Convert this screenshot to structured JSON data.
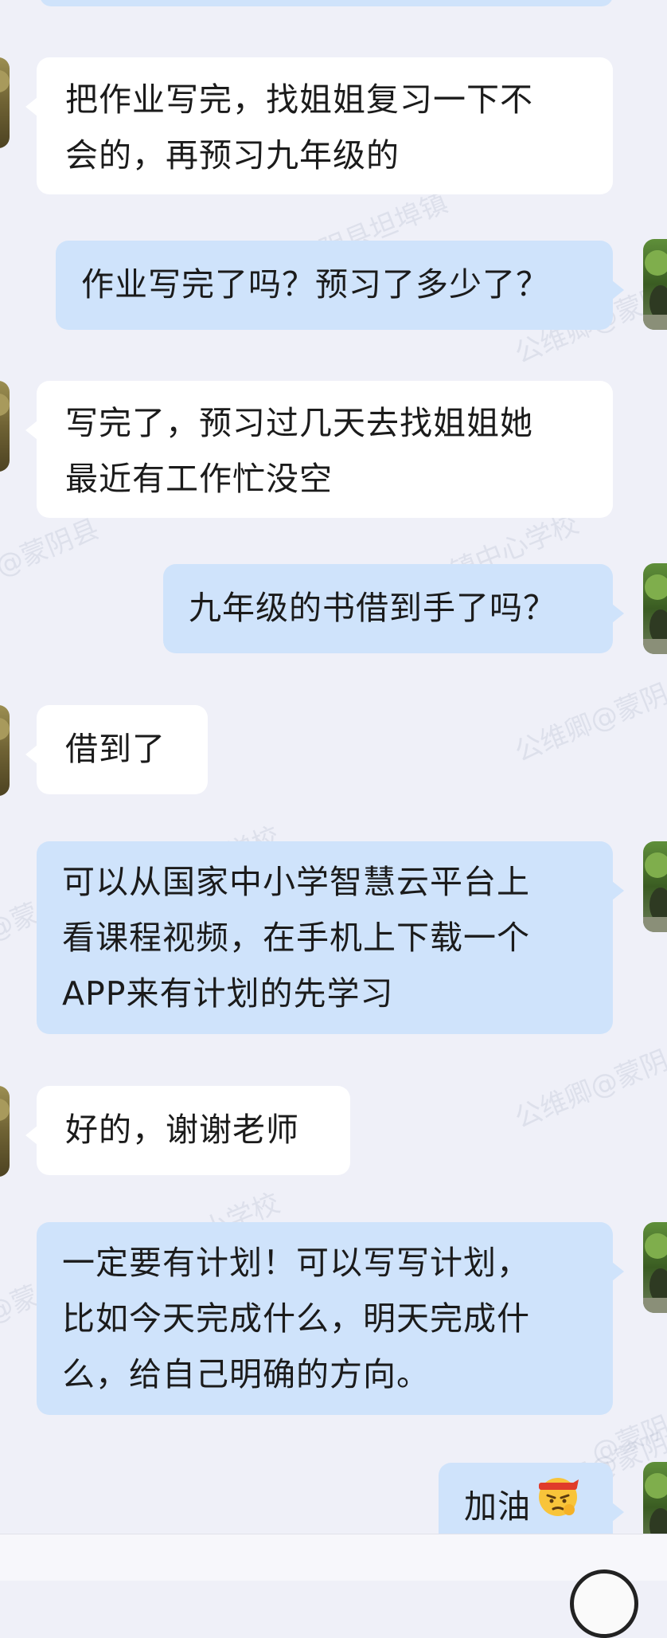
{
  "watermarks": [
    "@蒙阴县坦埠镇",
    "公维卿@蒙阴",
    "@蒙阴县",
    "镇中心学校",
    "公维卿@蒙阴",
    "小学校",
    "@蒙",
    "公维卿@蒙阴",
    "小学校",
    "@蒙",
    "公维卿@蒙阴",
    "@蒙阴"
  ],
  "messages": [
    {
      "side": "in",
      "lines": [
        "把作业写完，找姐姐复习一下不",
        "会的，再预习九年级的"
      ]
    },
    {
      "side": "out",
      "lines": [
        "作业写完了吗？预习了多少了？"
      ]
    },
    {
      "side": "in",
      "lines": [
        "写完了，预习过几天去找姐姐她",
        "最近有工作忙没空"
      ]
    },
    {
      "side": "out",
      "lines": [
        "九年级的书借到手了吗？"
      ]
    },
    {
      "side": "in",
      "lines": [
        "借到了"
      ]
    },
    {
      "side": "out",
      "lines": [
        "可以从国家中小学智慧云平台上",
        "看课程视频，在手机上下载一个",
        "APP来有计划的先学习"
      ]
    },
    {
      "side": "in",
      "lines": [
        "好的，谢谢老师"
      ]
    },
    {
      "side": "out",
      "lines": [
        "一定要有计划！可以写写计划，",
        "比如今天完成什么，明天完成什",
        "么，给自己明确的方向。"
      ]
    },
    {
      "side": "out",
      "lines": [
        "加油"
      ],
      "emoji": "determined-face-emoji"
    }
  ],
  "colors": {
    "background": "#eff0f8",
    "incoming_bubble": "#ffffff",
    "outgoing_bubble": "#cfe3fb"
  }
}
